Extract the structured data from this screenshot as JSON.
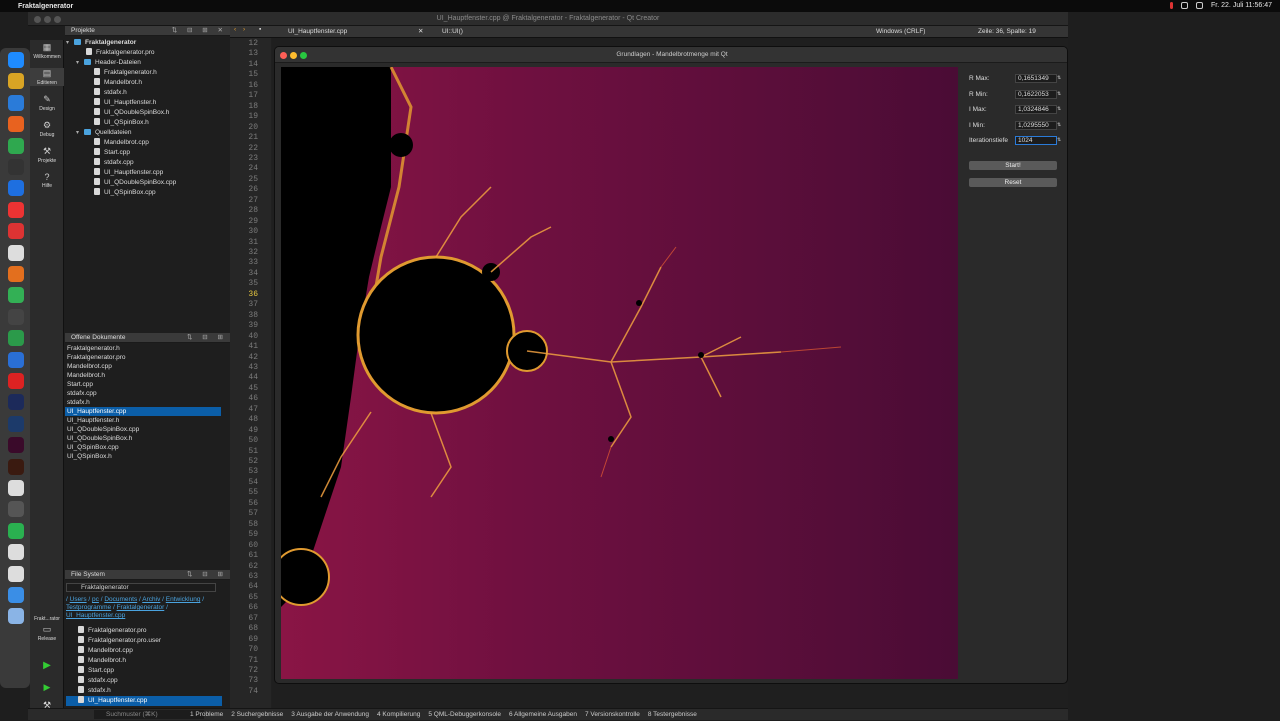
{
  "menubar": {
    "app_name": "Fraktalgenerator",
    "datetime": "Fr. 22. Juli  11:56:47"
  },
  "window": {
    "title": "UI_Hauptfenster.cpp @ Fraktalgenerator - Fraktalgenerator - Qt Creator"
  },
  "modes": [
    {
      "label": "Willkommen",
      "icon": "grid-icon"
    },
    {
      "label": "Editieren",
      "icon": "edit-icon"
    },
    {
      "label": "Design",
      "icon": "pen-icon"
    },
    {
      "label": "Debug",
      "icon": "bug-icon"
    },
    {
      "label": "Projekte",
      "icon": "wrench-icon"
    },
    {
      "label": "Hilfe",
      "icon": "help-icon"
    }
  ],
  "kit": {
    "name": "Fraktalgenerator",
    "short": "Frakt...rator",
    "config": "Release"
  },
  "projects": {
    "header": "Projekte",
    "root": "Fraktalgenerator",
    "pro_file": "Fraktalgenerator.pro",
    "header_folder": "Header-Dateien",
    "headers": [
      "Fraktalgenerator.h",
      "Mandelbrot.h",
      "stdafx.h",
      "UI_Hauptfenster.h",
      "UI_QDoubleSpinBox.h",
      "UI_QSpinBox.h"
    ],
    "source_folder": "Quelldateien",
    "sources": [
      "Mandelbrot.cpp",
      "Start.cpp",
      "stdafx.cpp",
      "UI_Hauptfenster.cpp",
      "UI_QDoubleSpinBox.cpp",
      "UI_QSpinBox.cpp"
    ]
  },
  "open_docs": {
    "header": "Offene Dokumente",
    "items": [
      "Fraktalgenerator.h",
      "Fraktalgenerator.pro",
      "Mandelbrot.cpp",
      "Mandelbrot.h",
      "Start.cpp",
      "stdafx.cpp",
      "stdafx.h",
      "UI_Hauptfenster.cpp",
      "UI_Hauptfenster.h",
      "UI_QDoubleSpinBox.cpp",
      "UI_QDoubleSpinBox.h",
      "UI_QSpinBox.cpp",
      "UI_QSpinBox.h"
    ],
    "selected": "UI_Hauptfenster.cpp"
  },
  "filesystem": {
    "header": "File System",
    "folder": "Fraktalgenerator",
    "path_parts": [
      "Users",
      "pc",
      "Documents",
      "Archiv",
      "Entwicklung",
      "Testprogramme",
      "Fraktalgenerator",
      "UI_Hauptfenster.cpp"
    ],
    "files": [
      "Fraktalgenerator.pro",
      "Fraktalgenerator.pro.user",
      "Mandelbrot.cpp",
      "Mandelbrot.h",
      "Start.cpp",
      "stdafx.cpp",
      "stdafx.h",
      "UI_Hauptfenster.cpp"
    ],
    "selected": "UI_Hauptfenster.cpp"
  },
  "editor": {
    "tab_file": "UI_Hauptfenster.cpp",
    "symbol": "UI::UI()",
    "line_ending": "Windows (CRLF)",
    "position": "Zeile: 36, Spalte: 19",
    "first_line": 12,
    "last_line": 74,
    "current_line": 36
  },
  "app_window": {
    "title": "Grundlagen - Mandelbrotmenge mit Qt",
    "fields": [
      {
        "label": "R Max:",
        "value": "0,1651349"
      },
      {
        "label": "R Min:",
        "value": "0,1622053"
      },
      {
        "label": "I Max:",
        "value": "1,0324846"
      },
      {
        "label": "I Min:",
        "value": "1,0295550"
      },
      {
        "label": "Iterationstiefe",
        "value": "1024"
      }
    ],
    "start_button": "Start!",
    "reset_button": "Reset"
  },
  "statusbar": {
    "search_placeholder": "Suchmuster (⌘K)",
    "tabs": [
      "1  Probleme",
      "2  Suchergebnisse",
      "3  Ausgabe der Anwendung",
      "4  Kompilierung",
      "5  QML-Debuggerkonsole",
      "6  Allgemeine Ausgaben",
      "7  Versionskontrolle",
      "8  Testergebnisse"
    ]
  },
  "colors": {
    "accent": "#0b5ea8",
    "fractal_bg": "#550c34",
    "fractal_edge": "#e8a030"
  }
}
